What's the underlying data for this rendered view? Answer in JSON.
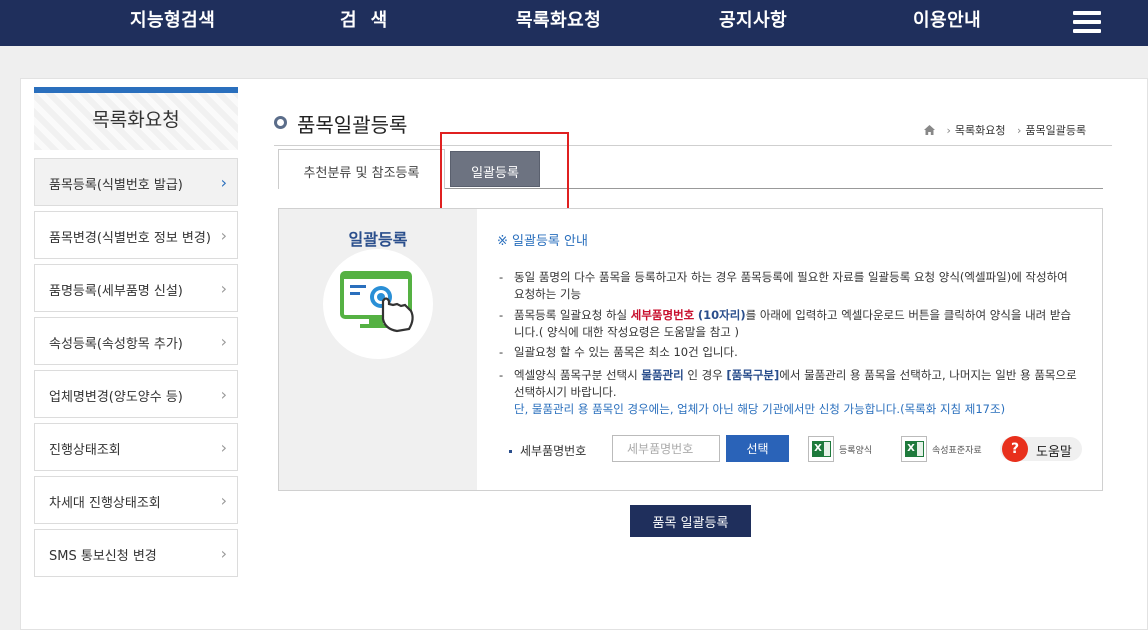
{
  "topnav": {
    "items": [
      "지능형검색",
      "검  색",
      "목록화요청",
      "공지사항",
      "이용안내"
    ],
    "menu_icon": "hamburger-icon"
  },
  "sidebar": {
    "title": "목록화요청",
    "items": [
      {
        "label": "품목등록(식별번호 발급)",
        "active": true
      },
      {
        "label": "품목변경(식별번호 정보 변경)"
      },
      {
        "label": "품명등록(세부품명 신설)"
      },
      {
        "label": "속성등록(속성항목 추가)"
      },
      {
        "label": "업체명변경(양도양수 등)"
      },
      {
        "label": "진행상태조회"
      },
      {
        "label": "차세대 진행상태조회"
      },
      {
        "label": "SMS 통보신청 변경"
      }
    ]
  },
  "content": {
    "title": "품목일괄등록",
    "breadcrumb": [
      "목록화요청",
      "품목일괄등록"
    ],
    "tabs": [
      "추천분류 및 참조등록",
      "일괄등록"
    ],
    "info": {
      "left_title": "일괄등록",
      "notice": "※ 일괄등록 안내",
      "bullets": {
        "b1": "동일 품명의 다수 품목을 등록하고자 하는 경우 품목등록에 필요한 자료를 일괄등록 요청 양식(엑셀파일)에 작성하여 요청하는 기능",
        "b2_pre": "품목등록 일괄요청 하실 ",
        "b2_red": "세부품명번호",
        "b2_blue": "(10자리)",
        "b2_post": "를 아래에 입력하고 엑셀다운로드 버튼을 클릭하여 양식을 내려 받습니다.( 양식에 대한 작성요령은 도움말을 참고 )",
        "b3": "일괄요청 할 수 있는 품목은 최소 10건 입니다.",
        "b4_pre": "엑셀양식 품목구분 선택시 ",
        "b4_blue1": "물품관리",
        "b4_mid": " 인 경우 ",
        "b4_blue2": "[품목구분]",
        "b4_post": "에서 물품관리 용 품목을 선택하고, 나머지는 일반 용 품목으로 선택하시기 바랍니다.",
        "b4_note": "단, 물품관리 용 품목인 경우에는, 업체가 아닌 해당 기관에서만 신청 가능합니다.(목록화 지침 제17조)"
      },
      "field_label": "세부품명번호",
      "field_placeholder": "세부품명번호",
      "select_button": "선택",
      "excel1": "등록양식",
      "excel2": "속성표준자료",
      "help": "도움말"
    },
    "submit": "품목 일괄등록"
  },
  "colors": {
    "nav": "#1f2f5c",
    "accent": "#2a6fbd",
    "highlight_box": "#e02020"
  }
}
